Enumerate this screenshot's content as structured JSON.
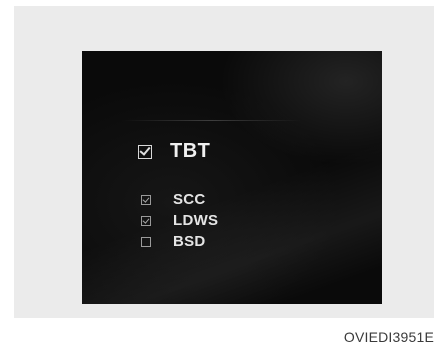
{
  "screen": {
    "options": [
      {
        "label": "TBT",
        "checked": true
      },
      {
        "label": "SCC",
        "checked": true
      },
      {
        "label": "LDWS",
        "checked": true
      },
      {
        "label": "BSD",
        "checked": false
      }
    ]
  },
  "caption": "OVIEDI3951E"
}
